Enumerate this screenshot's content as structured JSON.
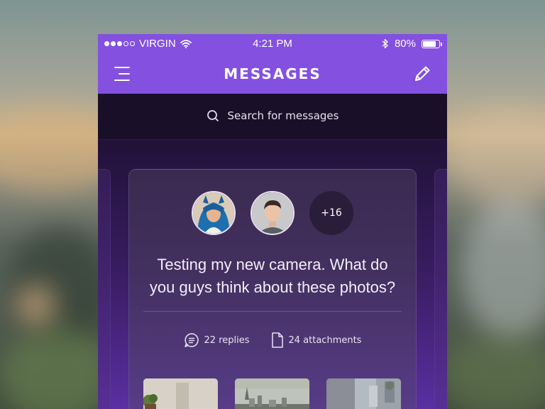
{
  "status_bar": {
    "carrier": "VIRGIN",
    "time": "4:21 PM",
    "battery_percent": "80%",
    "battery_level": 0.8,
    "signal_bars_filled": 3,
    "signal_bars_total": 5
  },
  "nav": {
    "title": "MESSAGES",
    "menu_icon": "hamburger-menu-icon",
    "compose_icon": "pencil-icon"
  },
  "search": {
    "placeholder": "Search for messages",
    "icon": "search-icon"
  },
  "card": {
    "more_participants": "+16",
    "message": "Testing my new camera. What do you guys think about these photos?",
    "replies": "22 replies",
    "attachments": "24 attachments"
  },
  "colors": {
    "accent": "#8350e0",
    "search_bg": "#1a0f28",
    "text_light": "#f3eefa"
  }
}
